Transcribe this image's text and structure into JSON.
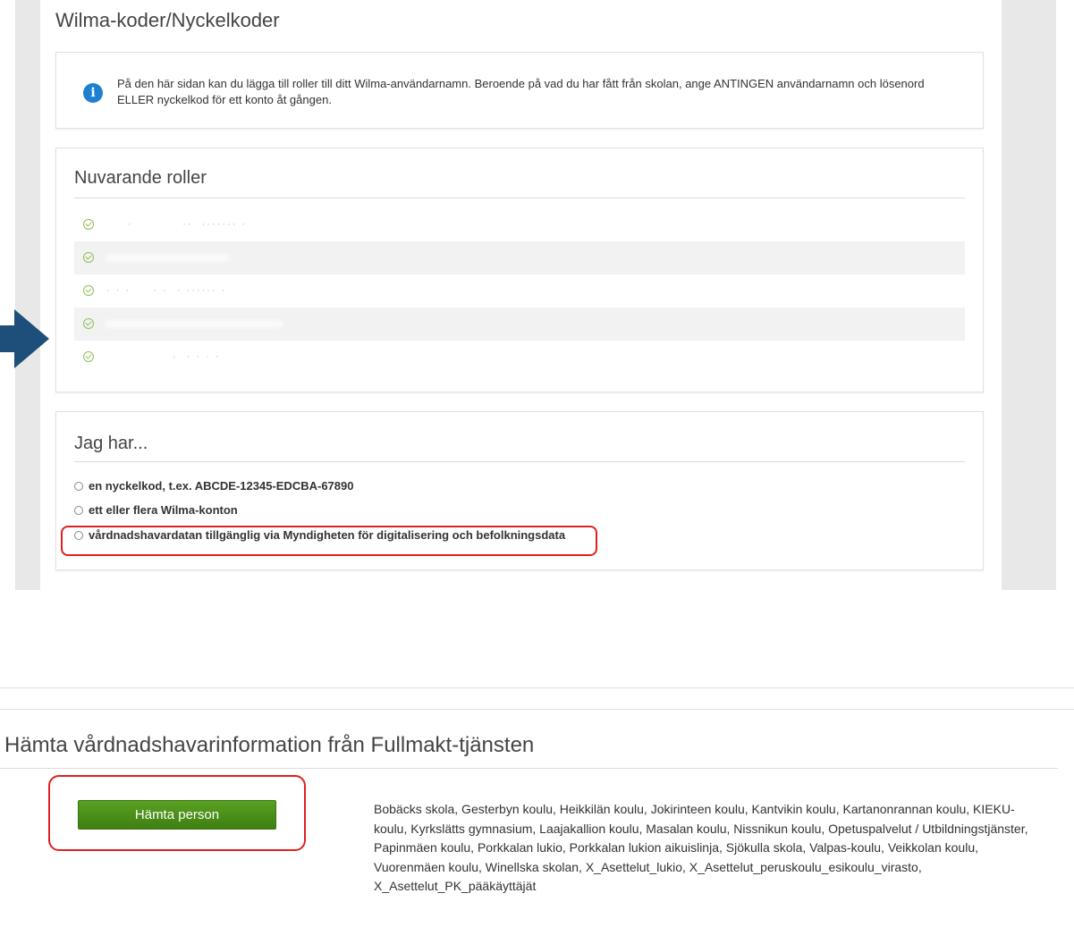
{
  "page": {
    "title": "Wilma-koder/Nyckelkoder"
  },
  "info": {
    "text": "På den här sidan kan du lägga till roller till ditt Wilma-användarnamn. Beroende på vad du har fått från skolan, ange ANTINGEN användarnamn och lösenord ELLER nyckelkod för ett konto åt gången."
  },
  "roles": {
    "heading": "Nuvarande roller"
  },
  "jag_har": {
    "heading": "Jag har...",
    "options": [
      "en nyckelkod, t.ex. ABCDE-12345-EDCBA-67890",
      "ett eller flera Wilma-konton",
      "vårdnadshavardatan tillgänglig via Myndigheten för digitalisering och befolkningsdata"
    ]
  },
  "fullmakt": {
    "title": "Hämta vårdnadshavarinformation från Fullmakt-tjänsten",
    "button_label": "Hämta person",
    "schools": "Bobäcks skola, Gesterbyn koulu, Heikkilän koulu, Jokirinteen koulu, Kantvikin koulu, Kartanonrannan koulu, KIEKU-koulu, Kyrkslätts gymnasium, Laajakallion koulu, Masalan koulu, Nissnikun koulu, Opetuspalvelut / Utbildningstjänster, Papinmäen koulu, Porkkalan lukio, Porkkalan lukion aikuislinja, Sjökulla skola, Valpas-koulu, Veikkolan koulu, Vuorenmäen koulu, Winellska skolan, X_Asettelut_lukio, X_Asettelut_peruskoulu_esikoulu_virasto, X_Asettelut_PK_pääkäyttäjät"
  },
  "colors": {
    "info_icon": "#1f7fd1",
    "check_icon": "#8cc152",
    "highlight": "#e02020",
    "button": "#4a8c1a",
    "arrow": "#1d4f7a"
  },
  "icons": {
    "info": "info-icon",
    "role_check": "check-circle-icon",
    "pointer": "arrow-right-icon"
  }
}
